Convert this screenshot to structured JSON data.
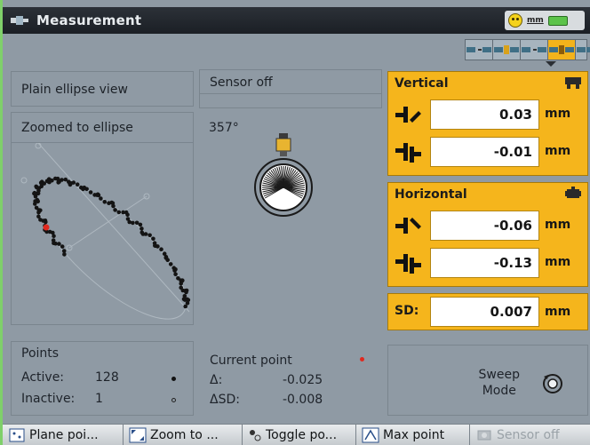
{
  "window": {
    "title": "Measurement",
    "status_units": "mm"
  },
  "left": {
    "view_mode": "Plain ellipse view",
    "zoom_mode": "Zoomed to ellipse",
    "points": {
      "heading": "Points",
      "active_label": "Active:",
      "active_value": "128",
      "inactive_label": "Inactive:",
      "inactive_value": "1"
    }
  },
  "middle": {
    "sensor_status": "Sensor off",
    "angle": "357°",
    "current_point": {
      "heading": "Current point",
      "delta_label": "Δ:",
      "delta_value": "-0.025",
      "dsd_label": "ΔSD:",
      "dsd_value": "-0.008"
    }
  },
  "vertical": {
    "heading": "Vertical",
    "offset_value": "0.03",
    "offset_unit": "mm",
    "angle_value": "-0.01",
    "angle_unit": "mm"
  },
  "horizontal": {
    "heading": "Horizontal",
    "offset_value": "-0.06",
    "offset_unit": "mm",
    "angle_value": "-0.13",
    "angle_unit": "mm"
  },
  "sd": {
    "label": "SD:",
    "value": "0.007",
    "unit": "mm"
  },
  "sweep": {
    "line1": "Sweep",
    "line2": "Mode"
  },
  "toolbar": {
    "plane_points": "Plane poi...",
    "zoom_to": "Zoom to ...",
    "toggle_points": "Toggle po...",
    "max_point": "Max point",
    "sensor_off": "Sensor off"
  },
  "colors": {
    "accent": "#f5b51c",
    "background": "#8f9aa4",
    "titlebar": "#1b1f25",
    "marker": "#e0291f"
  }
}
